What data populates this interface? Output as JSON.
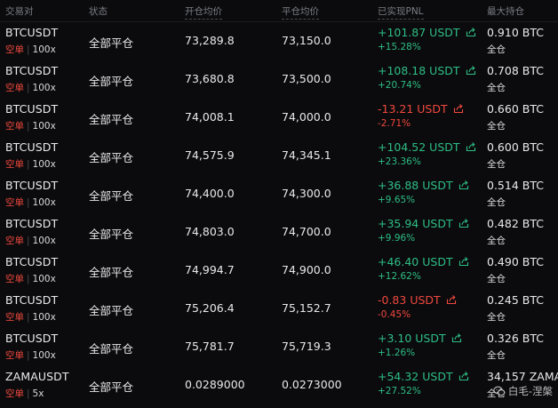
{
  "headers": {
    "pair": "交易对",
    "status": "状态",
    "open_avg": "开仓均价",
    "close_avg": "平仓均价",
    "pnl": "已实现PNL",
    "max_position": "最大持仓"
  },
  "icons": {
    "share": "share-icon",
    "watermark_logo": "wechat-logo-icon"
  },
  "colors": {
    "profit": "#2ebd85",
    "loss": "#f0483e",
    "short": "#f0483e",
    "background": "#0b0b0d"
  },
  "rows": [
    {
      "symbol": "BTCUSDT",
      "side": "空单",
      "leverage": "100x",
      "status": "全部平仓",
      "open_price": "73,289.8",
      "close_price": "73,150.0",
      "pnl": "+101.87 USDT",
      "pnl_pct": "+15.28%",
      "direction": "pos",
      "max_pos": "0.910 BTC",
      "margin_mode": "全仓"
    },
    {
      "symbol": "BTCUSDT",
      "side": "空单",
      "leverage": "100x",
      "status": "全部平仓",
      "open_price": "73,680.8",
      "close_price": "73,500.0",
      "pnl": "+108.18 USDT",
      "pnl_pct": "+20.74%",
      "direction": "pos",
      "max_pos": "0.708 BTC",
      "margin_mode": "全仓"
    },
    {
      "symbol": "BTCUSDT",
      "side": "空单",
      "leverage": "100x",
      "status": "全部平仓",
      "open_price": "74,008.1",
      "close_price": "74,000.0",
      "pnl": "-13.21 USDT",
      "pnl_pct": "-2.71%",
      "direction": "neg",
      "max_pos": "0.660 BTC",
      "margin_mode": "全仓"
    },
    {
      "symbol": "BTCUSDT",
      "side": "空单",
      "leverage": "100x",
      "status": "全部平仓",
      "open_price": "74,575.9",
      "close_price": "74,345.1",
      "pnl": "+104.52 USDT",
      "pnl_pct": "+23.36%",
      "direction": "pos",
      "max_pos": "0.600 BTC",
      "margin_mode": "全仓"
    },
    {
      "symbol": "BTCUSDT",
      "side": "空单",
      "leverage": "100x",
      "status": "全部平仓",
      "open_price": "74,400.0",
      "close_price": "74,300.0",
      "pnl": "+36.88 USDT",
      "pnl_pct": "+9.65%",
      "direction": "pos",
      "max_pos": "0.514 BTC",
      "margin_mode": "全仓"
    },
    {
      "symbol": "BTCUSDT",
      "side": "空单",
      "leverage": "100x",
      "status": "全部平仓",
      "open_price": "74,803.0",
      "close_price": "74,700.0",
      "pnl": "+35.94 USDT",
      "pnl_pct": "+9.96%",
      "direction": "pos",
      "max_pos": "0.482 BTC",
      "margin_mode": "全仓"
    },
    {
      "symbol": "BTCUSDT",
      "side": "空单",
      "leverage": "100x",
      "status": "全部平仓",
      "open_price": "74,994.7",
      "close_price": "74,900.0",
      "pnl": "+46.40 USDT",
      "pnl_pct": "+12.62%",
      "direction": "pos",
      "max_pos": "0.490 BTC",
      "margin_mode": "全仓"
    },
    {
      "symbol": "BTCUSDT",
      "side": "空单",
      "leverage": "100x",
      "status": "全部平仓",
      "open_price": "75,206.4",
      "close_price": "75,152.7",
      "pnl": "-0.83 USDT",
      "pnl_pct": "-0.45%",
      "direction": "neg",
      "max_pos": "0.245 BTC",
      "margin_mode": "全仓"
    },
    {
      "symbol": "BTCUSDT",
      "side": "空单",
      "leverage": "100x",
      "status": "全部平仓",
      "open_price": "75,781.7",
      "close_price": "75,719.3",
      "pnl": "+3.10 USDT",
      "pnl_pct": "+1.26%",
      "direction": "pos",
      "max_pos": "0.326 BTC",
      "margin_mode": "全仓"
    },
    {
      "symbol": "ZAMAUSDT",
      "side": "空单",
      "leverage": "5x",
      "status": "全部平仓",
      "open_price": "0.0289000",
      "close_price": "0.0273000",
      "pnl": "+54.32 USDT",
      "pnl_pct": "+27.52%",
      "direction": "pos",
      "max_pos": "34,157 ZAMA",
      "margin_mode": "全仓"
    }
  ],
  "watermark": {
    "text": "白毛-涅槃"
  }
}
